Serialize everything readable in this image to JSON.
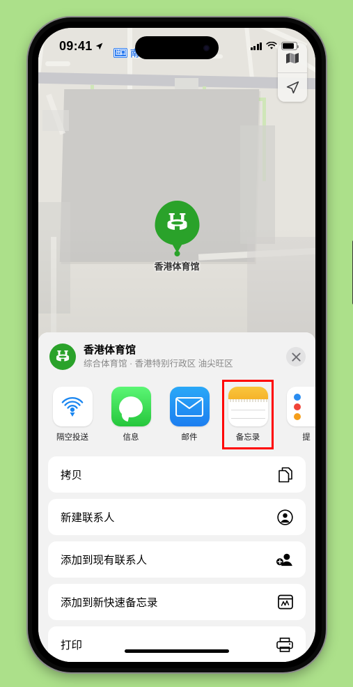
{
  "background_color": "#ACE08A",
  "status_bar": {
    "time": "09:41",
    "location_arrow": "location-arrow-icon",
    "cellular": "signal-bars-icon",
    "wifi": "wifi-icon",
    "battery": "battery-icon"
  },
  "map": {
    "transit_exit": {
      "badge": "出口",
      "label": "南口"
    },
    "poi": {
      "name": "香港体育馆",
      "pin_color": "#2aa22a",
      "icon": "stadium-icon"
    },
    "controls": [
      {
        "name": "map-layers-button",
        "icon": "map-layers-icon"
      },
      {
        "name": "locate-me-button",
        "icon": "navigation-arrow-icon"
      }
    ]
  },
  "share_sheet": {
    "title": "香港体育馆",
    "subtitle": "综合体育馆 · 香港特别行政区 油尖旺区",
    "close_icon": "close-icon",
    "thumbnail_icon": "stadium-icon",
    "apps": [
      {
        "label": "隔空投送",
        "icon": "airdrop-icon",
        "selected": false
      },
      {
        "label": "信息",
        "icon": "messages-icon",
        "selected": false
      },
      {
        "label": "邮件",
        "icon": "mail-icon",
        "selected": false
      },
      {
        "label": "备忘录",
        "icon": "notes-icon",
        "selected": true
      },
      {
        "label": "提",
        "icon": "reminders-icon",
        "selected": false
      }
    ],
    "selection_highlight_color": "#FF0000",
    "actions": [
      {
        "label": "拷贝",
        "icon": "copy-icon"
      },
      {
        "label": "新建联系人",
        "icon": "person-circle-icon"
      },
      {
        "label": "添加到现有联系人",
        "icon": "person-add-icon"
      },
      {
        "label": "添加到新快速备忘录",
        "icon": "quick-note-icon"
      },
      {
        "label": "打印",
        "icon": "printer-icon"
      }
    ]
  }
}
